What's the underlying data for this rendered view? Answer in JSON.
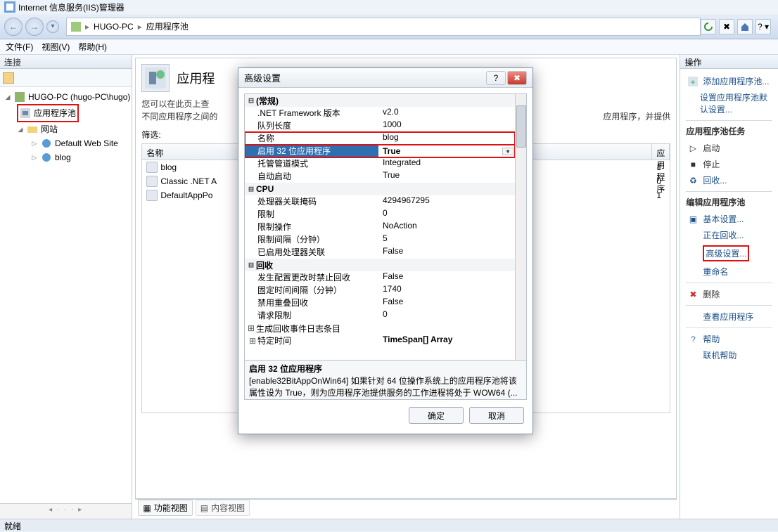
{
  "window": {
    "title": "Internet 信息服务(IIS)管理器"
  },
  "breadcrumb": {
    "machine": "HUGO-PC",
    "node": "应用程序池"
  },
  "menu": {
    "file": "文件(F)",
    "view": "视图(V)",
    "help": "帮助(H)"
  },
  "sidebar": {
    "header": "连接",
    "root": "HUGO-PC (hugo-PC\\hugo)",
    "app_pools": "应用程序池",
    "sites": "网站",
    "site_default": "Default Web Site",
    "site_blog": "blog"
  },
  "center": {
    "title": "应用程",
    "desc_a": "您可以在此页上查",
    "desc_b": "不同应用程序之间的",
    "desc_tail": "应用程序，并提供",
    "filter_label": "筛选:",
    "col_name": "名称",
    "col_app": "应用程序",
    "rows": [
      {
        "name": "blog",
        "app": "1"
      },
      {
        "name": "Classic .NET A",
        "app": "0"
      },
      {
        "name": "DefaultAppPo",
        "app": "1"
      }
    ],
    "view_feature": "功能视图",
    "view_content": "内容视图"
  },
  "actions": {
    "header": "操作",
    "add_pool": "添加应用程序池...",
    "set_defaults": "设置应用程序池默认设置...",
    "tasks_head": "应用程序池任务",
    "start": "启动",
    "stop": "停止",
    "recycle": "回收...",
    "edit_head": "编辑应用程序池",
    "basic": "基本设置...",
    "recycling": "正在回收...",
    "advanced": "高级设置...",
    "rename": "重命名",
    "delete": "删除",
    "view_apps": "查看应用程序",
    "help": "帮助",
    "online_help": "联机帮助"
  },
  "dialog": {
    "title": "高级设置",
    "cat_general": "(常规)",
    "k_net": ".NET Framework 版本",
    "v_net": "v2.0",
    "k_queue": "队列长度",
    "v_queue": "1000",
    "k_name": "名称",
    "v_name": "blog",
    "k_enable32": "启用 32 位应用程序",
    "v_enable32": "True",
    "k_pipeline": "托管管道模式",
    "v_pipeline": "Integrated",
    "k_autostart": "自动启动",
    "v_autostart": "True",
    "cat_cpu": "CPU",
    "k_affmask": "处理器关联掩码",
    "v_affmask": "4294967295",
    "k_limit": "限制",
    "v_limit": "0",
    "k_limitaction": "限制操作",
    "v_limitaction": "NoAction",
    "k_limitinterval": "限制间隔（分钟）",
    "v_limitinterval": "5",
    "k_affenabled": "已启用处理器关联",
    "v_affenabled": "False",
    "cat_recycle": "回收",
    "k_disallowoverlap": "发生配置更改时禁止回收",
    "v_disallowoverlap": "False",
    "k_periodic": "固定时间间隔（分钟）",
    "v_periodic": "1740",
    "k_disallowrotation": "禁用重叠回收",
    "v_disallowrotation": "False",
    "k_requests": "请求限制",
    "v_requests": "0",
    "k_logevents": "生成回收事件日志条目",
    "k_times": "特定时间",
    "v_times": "TimeSpan[] Array",
    "desc_title": "启用 32 位应用程序",
    "desc_body": "[enable32BitAppOnWin64] 如果针对 64 位操作系统上的应用程序池将该属性设为 True，则为应用程序池提供服务的工作进程将处于 WOW64 (...",
    "ok": "确定",
    "cancel": "取消"
  },
  "status": {
    "ready": "就绪"
  }
}
